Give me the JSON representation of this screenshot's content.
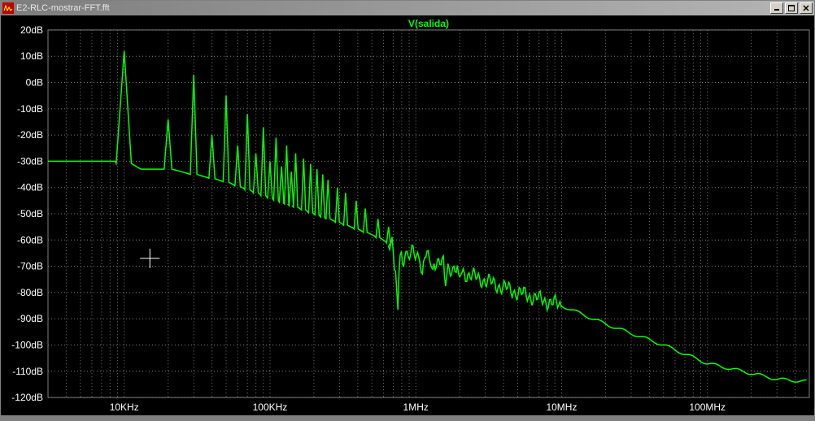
{
  "window": {
    "title": "E2-RLC-mostrar-FFT.fft",
    "icon_name": "ltspice-fft-icon",
    "buttons": {
      "minimize_glyph": "_",
      "maximize_glyph": "□",
      "close_glyph": "×"
    }
  },
  "chart_data": {
    "type": "line",
    "title": "V(salida)",
    "xlabel": "",
    "ylabel": "",
    "x_axis": {
      "type": "log",
      "min_hz": 3000,
      "max_hz": 500000000,
      "ticks": [
        {
          "hz": 10000,
          "label": "10KHz"
        },
        {
          "hz": 100000,
          "label": "100KHz"
        },
        {
          "hz": 1000000,
          "label": "1MHz"
        },
        {
          "hz": 10000000,
          "label": "10MHz"
        },
        {
          "hz": 100000000,
          "label": "100MHz"
        }
      ]
    },
    "y_axis": {
      "min_db": -120,
      "max_db": 20,
      "step_db": 10,
      "ticks": [
        {
          "db": 20,
          "label": "20dB"
        },
        {
          "db": 10,
          "label": "10dB"
        },
        {
          "db": 0,
          "label": "0dB"
        },
        {
          "db": -10,
          "label": "-10dB"
        },
        {
          "db": -20,
          "label": "-20dB"
        },
        {
          "db": -30,
          "label": "-30dB"
        },
        {
          "db": -40,
          "label": "-40dB"
        },
        {
          "db": -50,
          "label": "-50dB"
        },
        {
          "db": -60,
          "label": "-60dB"
        },
        {
          "db": -70,
          "label": "-70dB"
        },
        {
          "db": -80,
          "label": "-80dB"
        },
        {
          "db": -90,
          "label": "-90dB"
        },
        {
          "db": -100,
          "label": "-100dB"
        },
        {
          "db": -110,
          "label": "-110dB"
        },
        {
          "db": -120,
          "label": "-120dB"
        }
      ]
    },
    "series": [
      {
        "name": "V(salida)",
        "color": "#00ff00",
        "floor_points": [
          {
            "hz": 3000,
            "db": -30
          },
          {
            "hz": 9000,
            "db": -30
          },
          {
            "hz": 13000,
            "db": -33
          },
          {
            "hz": 20000,
            "db": -33
          },
          {
            "hz": 30000,
            "db": -35
          },
          {
            "hz": 50000,
            "db": -38
          },
          {
            "hz": 100000,
            "db": -44
          },
          {
            "hz": 200000,
            "db": -50
          },
          {
            "hz": 500000,
            "db": -58
          },
          {
            "hz": 700000,
            "db": -62
          },
          {
            "hz": 1000000,
            "db": -65
          },
          {
            "hz": 2000000,
            "db": -72
          },
          {
            "hz": 5000000,
            "db": -80
          },
          {
            "hz": 10000000,
            "db": -85
          },
          {
            "hz": 20000000,
            "db": -92
          },
          {
            "hz": 50000000,
            "db": -100
          },
          {
            "hz": 100000000,
            "db": -107
          },
          {
            "hz": 300000000,
            "db": -113
          },
          {
            "hz": 500000000,
            "db": -114
          }
        ],
        "harmonics": [
          {
            "n": 1,
            "hz": 10000,
            "db": 12
          },
          {
            "n": 2,
            "hz": 20000,
            "db": -14
          },
          {
            "n": 3,
            "hz": 30000,
            "db": 3
          },
          {
            "n": 4,
            "hz": 40000,
            "db": -20
          },
          {
            "n": 5,
            "hz": 50000,
            "db": -5
          },
          {
            "n": 6,
            "hz": 60000,
            "db": -24
          },
          {
            "n": 7,
            "hz": 70000,
            "db": -12
          },
          {
            "n": 8,
            "hz": 80000,
            "db": -27
          },
          {
            "n": 9,
            "hz": 90000,
            "db": -17
          },
          {
            "n": 10,
            "hz": 100000,
            "db": -30
          },
          {
            "n": 11,
            "hz": 110000,
            "db": -21
          },
          {
            "n": 12,
            "hz": 120000,
            "db": -32
          },
          {
            "n": 13,
            "hz": 130000,
            "db": -24
          },
          {
            "n": 14,
            "hz": 140000,
            "db": -34
          },
          {
            "n": 15,
            "hz": 150000,
            "db": -27
          },
          {
            "n": 17,
            "hz": 170000,
            "db": -29
          },
          {
            "n": 19,
            "hz": 190000,
            "db": -31
          },
          {
            "n": 21,
            "hz": 210000,
            "db": -33
          },
          {
            "n": 23,
            "hz": 230000,
            "db": -35
          },
          {
            "n": 25,
            "hz": 250000,
            "db": -37
          },
          {
            "n": 29,
            "hz": 290000,
            "db": -40
          },
          {
            "n": 33,
            "hz": 330000,
            "db": -42
          },
          {
            "n": 39,
            "hz": 390000,
            "db": -45
          },
          {
            "n": 45,
            "hz": 450000,
            "db": -48
          },
          {
            "n": 55,
            "hz": 550000,
            "db": -52
          },
          {
            "n": 65,
            "hz": 650000,
            "db": -55
          }
        ],
        "noise_dips": [
          {
            "hz": 720000,
            "db": -75
          },
          {
            "hz": 750000,
            "db": -90
          },
          {
            "hz": 820000,
            "db": -72
          },
          {
            "hz": 900000,
            "db": -68
          },
          {
            "hz": 1100000,
            "db": -75
          },
          {
            "hz": 1300000,
            "db": -72
          },
          {
            "hz": 1600000,
            "db": -78
          },
          {
            "hz": 2000000,
            "db": -74
          }
        ]
      }
    ],
    "cursor": {
      "x_hz": 15000,
      "y_db": -67
    },
    "trace_label_text": "V(salida)"
  }
}
